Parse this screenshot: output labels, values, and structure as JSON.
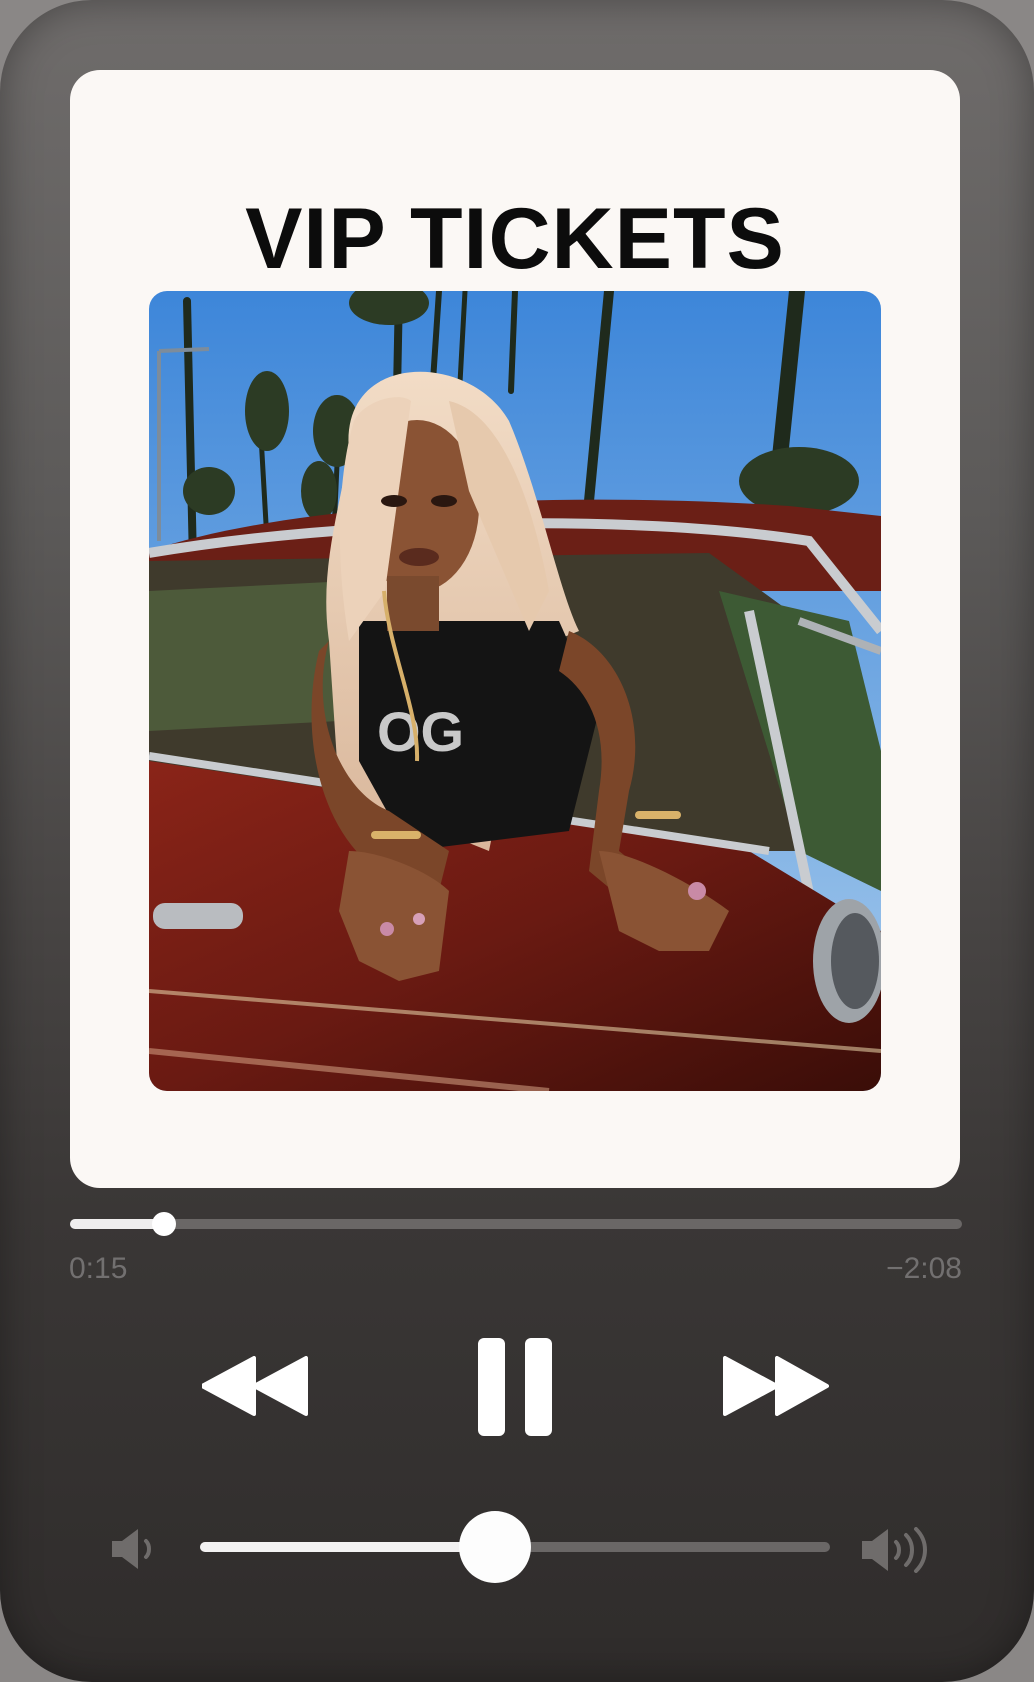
{
  "card": {
    "title": "VIP TICKETS"
  },
  "artwork": {
    "image": "woman-leaning-out-of-red-lowrider-car-window-with-palm-trees"
  },
  "playback": {
    "elapsed": "0:15",
    "remaining": "−2:08",
    "progress_fraction": 0.105
  },
  "controls": {
    "rewind_icon": "rewind-icon",
    "pause_icon": "pause-icon",
    "forward_icon": "fast-forward-icon"
  },
  "volume": {
    "level_fraction": 0.468,
    "min_icon": "volume-low-icon",
    "max_icon": "volume-high-icon"
  },
  "colors": {
    "card_background": "#fbf8f5",
    "title_text": "#0c0c0c",
    "control_white": "#ffffff",
    "track_inactive": "#6a6766",
    "time_text": "#727070"
  }
}
